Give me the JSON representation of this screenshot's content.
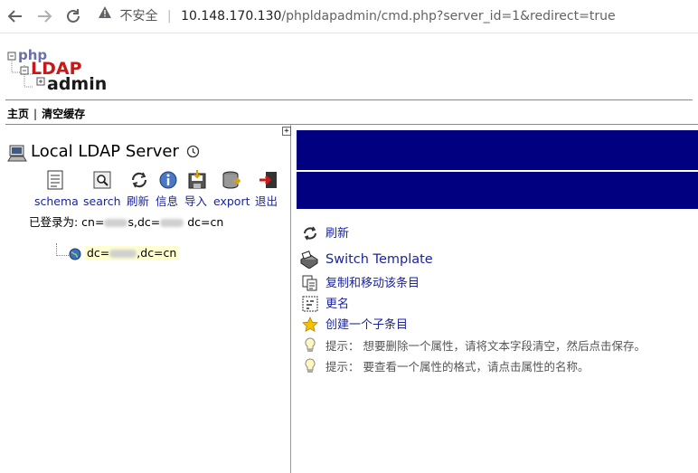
{
  "browser": {
    "insecure_label": "不安全",
    "url_host": "10.148.170.130",
    "url_path": "/phpldapadmin/cmd.php?server_id=1&redirect=true"
  },
  "logo": {
    "line1": "php",
    "line2": "LDAP",
    "line3": "admin"
  },
  "topmenu": {
    "home": "主页",
    "separator": "|",
    "clear_cache": "清空缓存"
  },
  "left": {
    "expand_symbol": "+",
    "server_name": "Local LDAP Server",
    "toolbar": [
      {
        "label": "schema",
        "icon": "schema-icon"
      },
      {
        "label": "search",
        "icon": "search-icon"
      },
      {
        "label": "刷新",
        "icon": "refresh-icon"
      },
      {
        "label": "信息",
        "icon": "info-icon"
      },
      {
        "label": "导入",
        "icon": "import-icon"
      },
      {
        "label": "export",
        "icon": "export-icon"
      },
      {
        "label": "退出",
        "icon": "logout-icon"
      }
    ],
    "logged_in_prefix": "已登录为: cn=",
    "logged_in_mid1": "s,dc=",
    "logged_in_mid2": "dc=cn",
    "tree_item_prefix": "dc=",
    "tree_item_suffix": ",dc=cn"
  },
  "right": {
    "actions": [
      {
        "label": "刷新",
        "icon": "refresh-icon"
      },
      {
        "label": "Switch Template",
        "icon": "switch-template-icon"
      },
      {
        "label": "复制和移动该条目",
        "icon": "copy-move-icon"
      },
      {
        "label": "更名",
        "icon": "rename-icon"
      },
      {
        "label": "创建一个子条目",
        "icon": "star-icon"
      }
    ],
    "hints": [
      {
        "label": "提示： 想要删除一个属性，请将文本字段清空，然后点击保存。",
        "icon": "lightbulb-icon"
      },
      {
        "label": "提示： 要查看一个属性的格式，请点击属性的名称。",
        "icon": "lightbulb-icon"
      }
    ]
  },
  "colors": {
    "link": "#1a24a0",
    "bluebar": "#000080",
    "tree_highlight": "#ffffd2"
  }
}
